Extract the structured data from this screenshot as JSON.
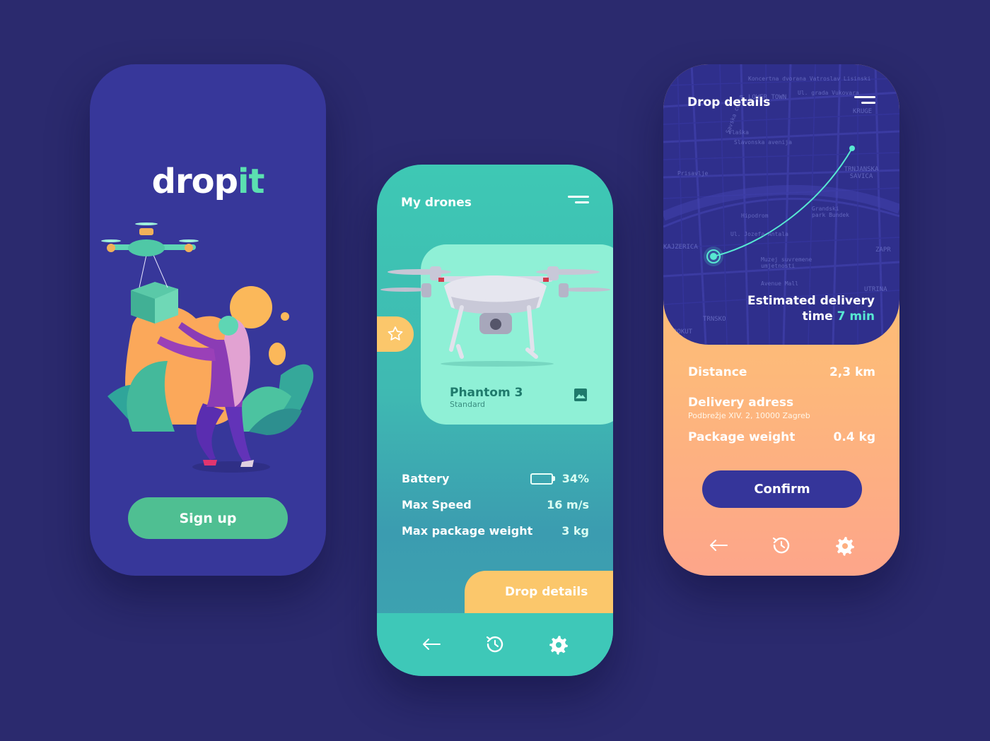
{
  "colors": {
    "background": "#2b2a6e",
    "primary_purple": "#37379a",
    "teal": "#3ec8b4",
    "mint": "#8ff0d6",
    "orange": "#fbc76b",
    "green_button": "#4fbf92",
    "route_cyan": "#57e8d2"
  },
  "screen1": {
    "logo_main": "drop",
    "logo_accent": "it",
    "signup_label": "Sign up",
    "illustration": "woman-receiving-drone-package"
  },
  "screen2": {
    "title": "My drones",
    "menu_icon": "menu-icon",
    "fav_icon": "star-icon",
    "drone": {
      "name": "Phantom 3",
      "type": "Standard",
      "image_icon": "image-icon"
    },
    "stats": [
      {
        "label": "Battery",
        "value": "34%",
        "level": 0.34
      },
      {
        "label": "Max Speed",
        "value": "16 m/s"
      },
      {
        "label": "Max package weight",
        "value": "3 kg"
      }
    ],
    "drop_details_label": "Drop details",
    "nav": [
      "back-arrow-icon",
      "history-icon",
      "settings-icon"
    ]
  },
  "screen3": {
    "title": "Drop details",
    "map_labels": [
      "Koncertna dvorana Vatroslav Lisinski",
      "Ul. grada Vukovara",
      "LOWER TOWN",
      "KRUGE",
      "Vlaška",
      "Slavonska avenija",
      "TRNJANSKA SAVICA",
      "Hipodrom",
      "Grandski park Bundek",
      "Ul. Jozefa Antala",
      "KAJZERICA",
      "Muzej suvremene umjetnosti",
      "ZAPR",
      "Avenue Mall",
      "UTRINA",
      "TRNSKO",
      "ROKUT",
      "Savska cesta",
      "Prisavlje"
    ],
    "eta_line1": "Estimated delivery",
    "eta_prefix": "time",
    "eta_value": "7 min",
    "details": {
      "distance_label": "Distance",
      "distance_value": "2,3 km",
      "address_label": "Delivery adress",
      "address_value": "Podbrežje XIV. 2, 10000 Zagreb",
      "weight_label": "Package weight",
      "weight_value": "0.4 kg"
    },
    "confirm_label": "Confirm",
    "nav": [
      "back-arrow-icon",
      "history-icon",
      "settings-icon"
    ]
  }
}
